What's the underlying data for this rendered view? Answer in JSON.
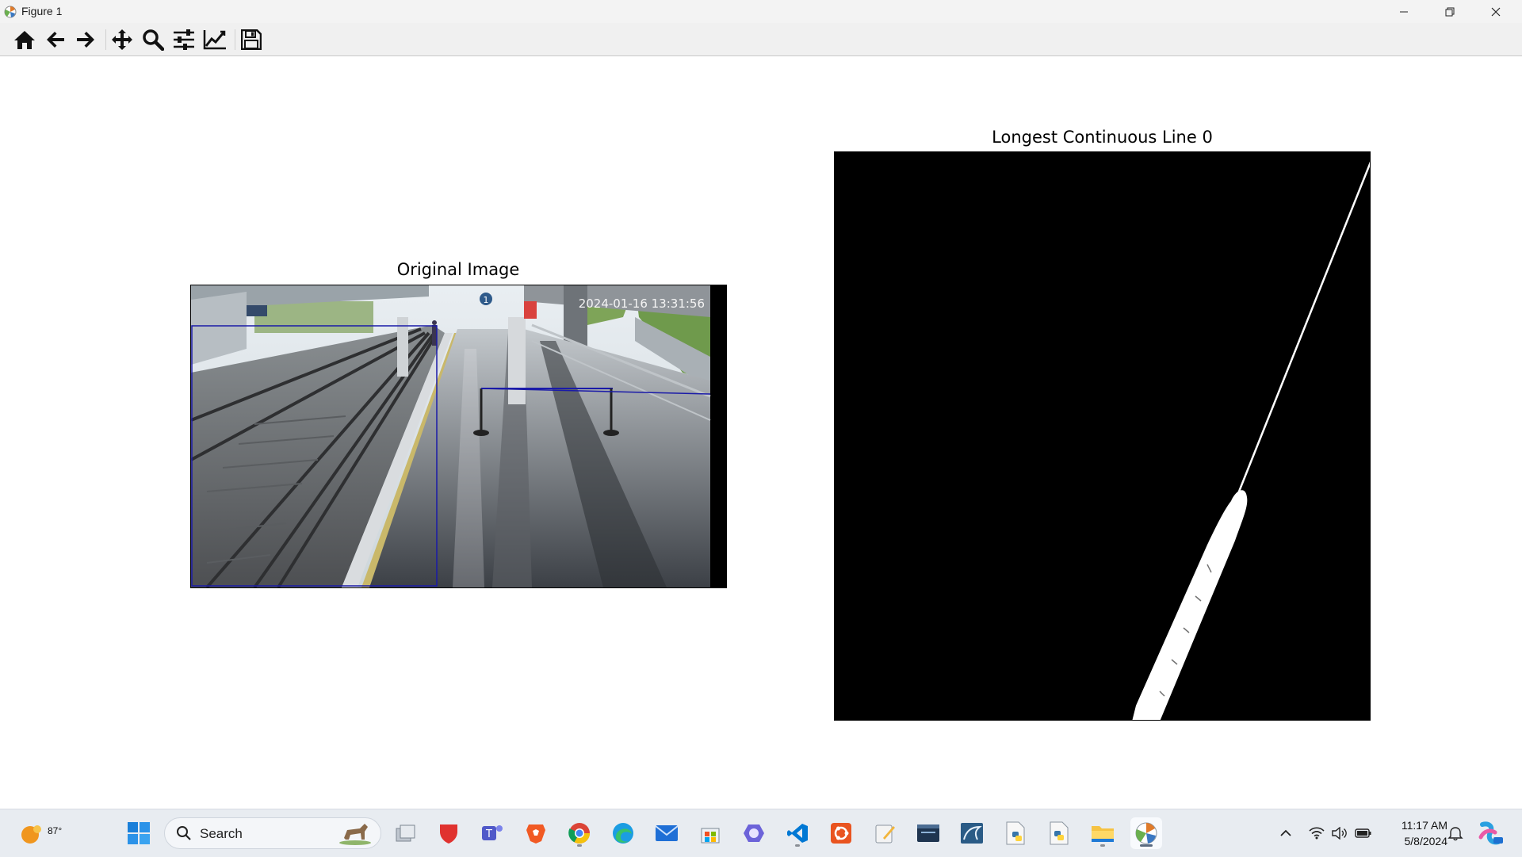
{
  "window": {
    "title": "Figure 1",
    "controls": [
      "minimize-icon",
      "restore-icon",
      "close-icon"
    ]
  },
  "toolbar": {
    "buttons": [
      "home-icon",
      "back-arrow-icon",
      "forward-arrow-icon",
      "pan-icon",
      "zoom-icon",
      "configure-subplots-icon",
      "edit-axes-icon",
      "save-icon"
    ]
  },
  "figure": {
    "left_axes": {
      "title": "Original Image",
      "image_overlay_text": "2024-01-16 13:31:56",
      "sign_text": "1"
    },
    "right_axes": {
      "title": "Longest Continuous Line 0"
    }
  },
  "taskbar": {
    "weather_temp": "87°",
    "search_placeholder": "Search",
    "apps": [
      "start-icon",
      "task-view-icon",
      "shield-app-icon",
      "teams-icon",
      "brave-icon",
      "chrome-icon",
      "edge-icon",
      "mail-icon",
      "store-icon",
      "copilot-icon",
      "vscode-icon",
      "ubuntu-icon",
      "notepad-icon",
      "mysql-workbench-icon",
      "mysql-icon",
      "python-file-icon",
      "python-idle-icon",
      "file-explorer-icon",
      "matplotlib-figure-icon"
    ],
    "clock_time": "11:17 AM",
    "clock_date": "5/8/2024",
    "tray": [
      "chevron-up-icon",
      "wifi-icon",
      "volume-icon",
      "battery-icon"
    ]
  },
  "colors": {
    "overlay_box": "#1a1aa8",
    "mask_bg": "#000000",
    "mask_line": "#ffffff"
  }
}
